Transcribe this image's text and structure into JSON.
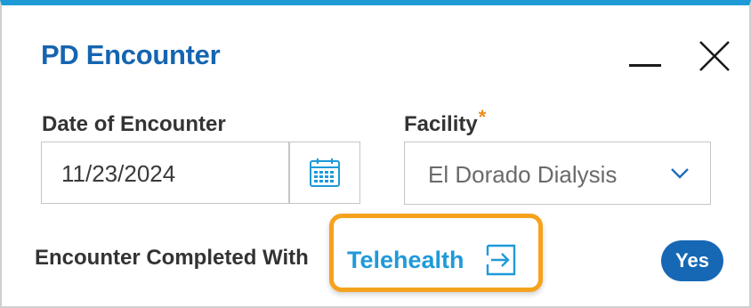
{
  "dialog": {
    "title": "PD Encounter",
    "accent_color": "#1e9ad6",
    "title_color": "#1565b0"
  },
  "window_controls": {
    "minimize_icon": "minimize-icon",
    "close_icon": "close-icon"
  },
  "date_of_encounter": {
    "label": "Date of Encounter",
    "value": "11/23/2024",
    "icon": "calendar-icon"
  },
  "facility": {
    "label": "Facility",
    "required_marker": "*",
    "selected_value": "El Dorado Dialysis",
    "icon": "chevron-down-icon"
  },
  "encounter_completed": {
    "label": "Encounter Completed With",
    "link_text": "Telehealth",
    "link_icon": "external-arrow-icon",
    "link_color": "#1f9ad8",
    "highlight_color": "#f5a21d",
    "toggle_value": "Yes",
    "toggle_color": "#1668b4"
  }
}
